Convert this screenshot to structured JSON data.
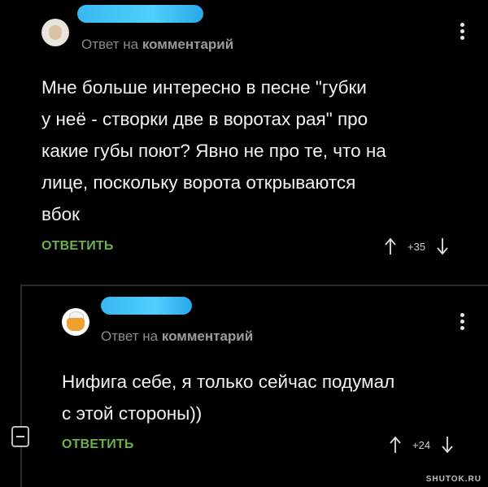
{
  "comments": [
    {
      "reply_prefix": "Ответ на",
      "reply_target": "комментарий",
      "text_lines": [
        "Мне больше интересно в песне \"губки",
        "у неё - створки две в воротах рая\" про",
        "какие губы поют? Явно не про те, что на",
        "лице, поскольку ворота открываются",
        "вбок"
      ],
      "reply_label": "ОТВЕТИТЬ",
      "rating": "+35",
      "avatar_icon": "user-avatar-icon"
    },
    {
      "reply_prefix": "Ответ на",
      "reply_target": "комментарий",
      "text_lines": [
        "Нифига себе, я только сейчас подумал",
        "с этой стороны))"
      ],
      "reply_label": "ОТВЕТИТЬ",
      "rating": "+24",
      "avatar_icon": "user-avatar-icon"
    }
  ],
  "watermark": "SHUTOK.RU",
  "colors": {
    "background": "#000000",
    "reply_button": "#6ab04c",
    "username_redaction": "#38b8f0",
    "meta_text": "#8a8a8a"
  }
}
